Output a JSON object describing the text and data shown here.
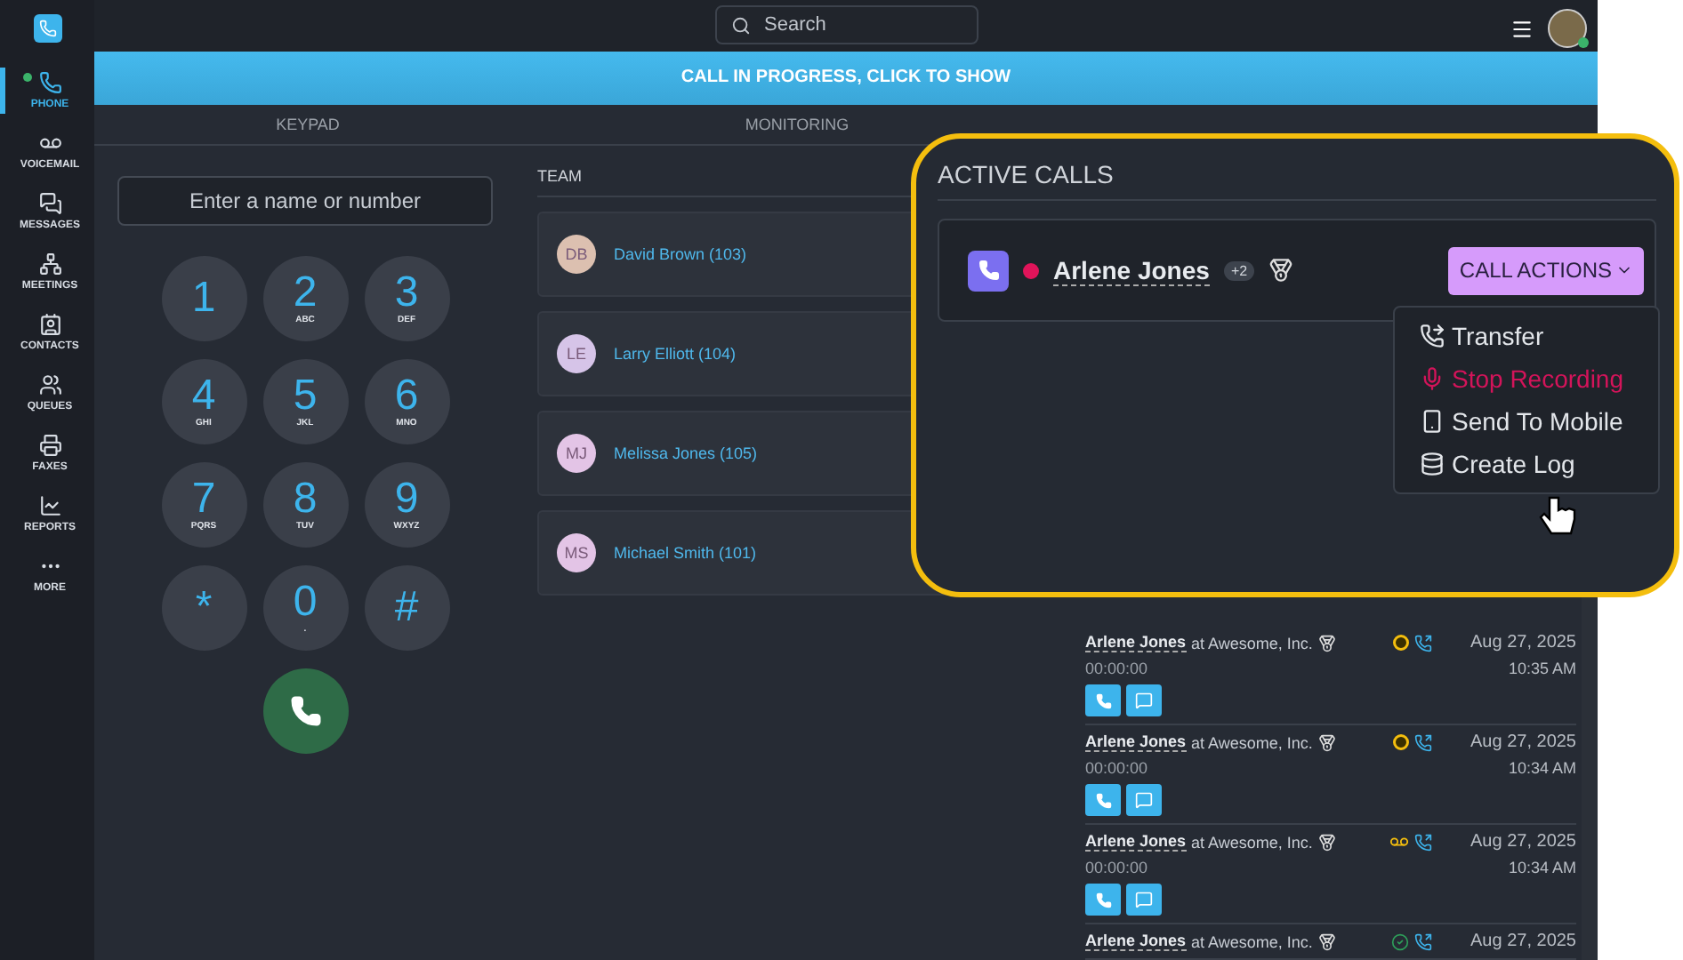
{
  "sidebar": {
    "items": [
      {
        "label": "PHONE",
        "kind": "phone",
        "selected": true,
        "online": true
      },
      {
        "label": "VOICEMAIL",
        "kind": "voicemail",
        "selected": false,
        "online": false
      },
      {
        "label": "MESSAGES",
        "kind": "messages",
        "selected": false,
        "online": false
      },
      {
        "label": "MEETINGS",
        "kind": "meetings",
        "selected": false,
        "online": false
      },
      {
        "label": "CONTACTS",
        "kind": "contacts",
        "selected": false,
        "online": false
      },
      {
        "label": "QUEUES",
        "kind": "queues",
        "selected": false,
        "online": false
      },
      {
        "label": "FAXES",
        "kind": "faxes",
        "selected": false,
        "online": false
      },
      {
        "label": "REPORTS",
        "kind": "reports",
        "selected": false,
        "online": false
      },
      {
        "label": "MORE",
        "kind": "more",
        "selected": false,
        "online": false
      }
    ]
  },
  "topbar": {
    "search": {
      "placeholder": "Search"
    },
    "user_online": true
  },
  "banner": "CALL IN PROGRESS, CLICK TO SHOW",
  "tabs": [
    {
      "label": "KEYPAD",
      "selected": false
    },
    {
      "label": "MONITORING",
      "selected": false
    }
  ],
  "keypad": {
    "field": {
      "placeholder": "Enter a name or number"
    },
    "keys": [
      {
        "digit": "1"
      },
      {
        "digit": "2",
        "letters": "ABC"
      },
      {
        "digit": "3",
        "letters": "DEF"
      },
      {
        "digit": "4",
        "letters": "GHI"
      },
      {
        "digit": "5",
        "letters": "JKL"
      },
      {
        "digit": "6",
        "letters": "MNO"
      },
      {
        "digit": "7",
        "letters": "PQRS"
      },
      {
        "digit": "8",
        "letters": "TUV"
      },
      {
        "digit": "9",
        "letters": "WXYZ"
      },
      {
        "digit": "*"
      },
      {
        "digit": "0",
        "letters": "."
      },
      {
        "digit": "#"
      }
    ]
  },
  "team": {
    "title": "TEAM",
    "members": [
      {
        "initials": "DB",
        "name": "David Brown (103)",
        "color": "#dcc0b0"
      },
      {
        "initials": "LE",
        "name": "Larry Elliott (104)",
        "color": "#d6c4e8"
      },
      {
        "initials": "MJ",
        "name": "Melissa Jones (105)",
        "color": "#e3c4e6"
      },
      {
        "initials": "MS",
        "name": "Michael Smith (101)",
        "color": "#e3c4e6"
      }
    ]
  },
  "recent_calls": [
    {
      "name": "Arlene Jones",
      "company": "at Awesome, Inc.",
      "kind": "recording",
      "date": "Aug 27, 2025",
      "duration": "00:00:00",
      "time": "10:35 AM"
    },
    {
      "name": "Arlene Jones",
      "company": "at Awesome, Inc.",
      "kind": "recording",
      "date": "Aug 27, 2025",
      "duration": "00:00:00",
      "time": "10:34 AM"
    },
    {
      "name": "Arlene Jones",
      "company": "at Awesome, Inc.",
      "kind": "voicemail",
      "date": "Aug 27, 2025",
      "duration": "00:00:00",
      "time": "10:34 AM"
    },
    {
      "name": "Arlene Jones",
      "company": "at Awesome, Inc.",
      "kind": "answered",
      "date": "Aug 27, 2025"
    }
  ],
  "active_calls": {
    "title": "ACTIVE CALLS",
    "call": {
      "name": "Arlene Jones",
      "extra": "+2",
      "recording": true
    },
    "button": "CALL ACTIONS",
    "menu": [
      {
        "label": "Transfer",
        "kind": "transfer"
      },
      {
        "label": "Stop Recording",
        "kind": "record"
      },
      {
        "label": "Send To Mobile",
        "kind": "mobile"
      },
      {
        "label": "Create Log",
        "kind": "log"
      }
    ]
  }
}
